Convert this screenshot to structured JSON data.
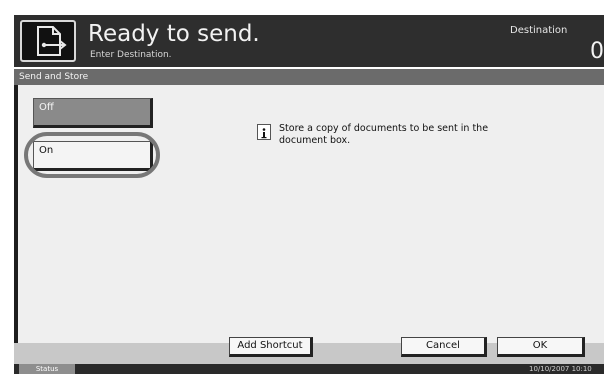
{
  "header": {
    "title": "Ready to send.",
    "subtitle": "Enter Destination.",
    "destination_label": "Destination",
    "destination_count": "0",
    "icon": "send-icon"
  },
  "section": {
    "title": "Send and Store"
  },
  "options": {
    "off_label": "Off",
    "on_label": "On",
    "selected": "On"
  },
  "info": {
    "icon": "info-icon",
    "text": "Store a copy of documents to be sent in the document box."
  },
  "footer": {
    "add_shortcut_label": "Add Shortcut",
    "cancel_label": "Cancel",
    "ok_label": "OK"
  },
  "status": {
    "label": "Status",
    "datetime": "10/10/2007  10:10"
  },
  "colors": {
    "header_bg": "#2e2e2e",
    "section_bar": "#6b6b6b",
    "content_bg": "#efefef",
    "off_button": "#8a8a8a",
    "on_button": "#f4f4f4",
    "status_bar": "#2a2a2a"
  }
}
